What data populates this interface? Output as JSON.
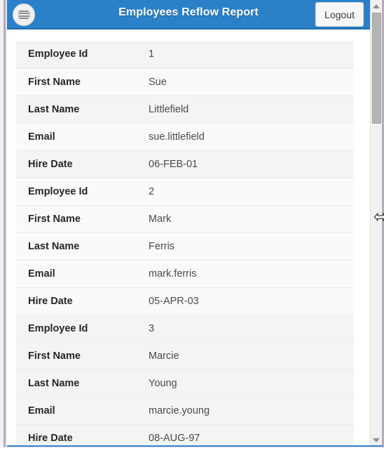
{
  "header": {
    "title": "Employees Reflow Report",
    "menu_icon": "hamburger-menu-icon",
    "logout_label": "Logout",
    "background_color": "#2a81c8",
    "title_color": "#ffffff"
  },
  "report": {
    "field_labels": {
      "employee_id": "Employee Id",
      "first_name": "First Name",
      "last_name": "Last Name",
      "email": "Email",
      "hire_date": "Hire Date"
    },
    "records": [
      {
        "employee_id": "1",
        "first_name": "Sue",
        "last_name": "Littlefield",
        "email": "sue.littlefield",
        "hire_date": "06-FEB-01"
      },
      {
        "employee_id": "2",
        "first_name": "Mark",
        "last_name": "Ferris",
        "email": "mark.ferris",
        "hire_date": "05-APR-03"
      },
      {
        "employee_id": "3",
        "first_name": "Marcie",
        "last_name": "Young",
        "email": "marcie.young",
        "hire_date": "08-AUG-97"
      }
    ]
  },
  "scrollbar": {
    "up_arrow_icon": "scroll-up-arrow-icon",
    "down_arrow_icon": "scroll-down-arrow-icon",
    "thumb_icon": "scrollbar-thumb"
  },
  "cursor": {
    "icon": "horizontal-resize-cursor-icon"
  }
}
